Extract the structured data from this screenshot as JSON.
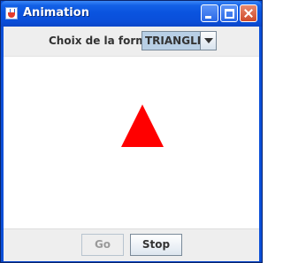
{
  "window": {
    "title": "Animation",
    "icon": "java-cup-icon"
  },
  "controls": {
    "shape_label": "Choix de la forme",
    "shape_select": {
      "selected": "TRIANGLE",
      "icon": "chevron-down-icon"
    }
  },
  "canvas": {
    "shape": "triangle",
    "shape_color": "#ff0000"
  },
  "buttons": {
    "go_label": "Go",
    "go_enabled": false,
    "stop_label": "Stop",
    "stop_enabled": true
  },
  "colors": {
    "titlebar": "#0a54df",
    "panel": "#eeeeee",
    "combo": "#b8cfe5"
  }
}
